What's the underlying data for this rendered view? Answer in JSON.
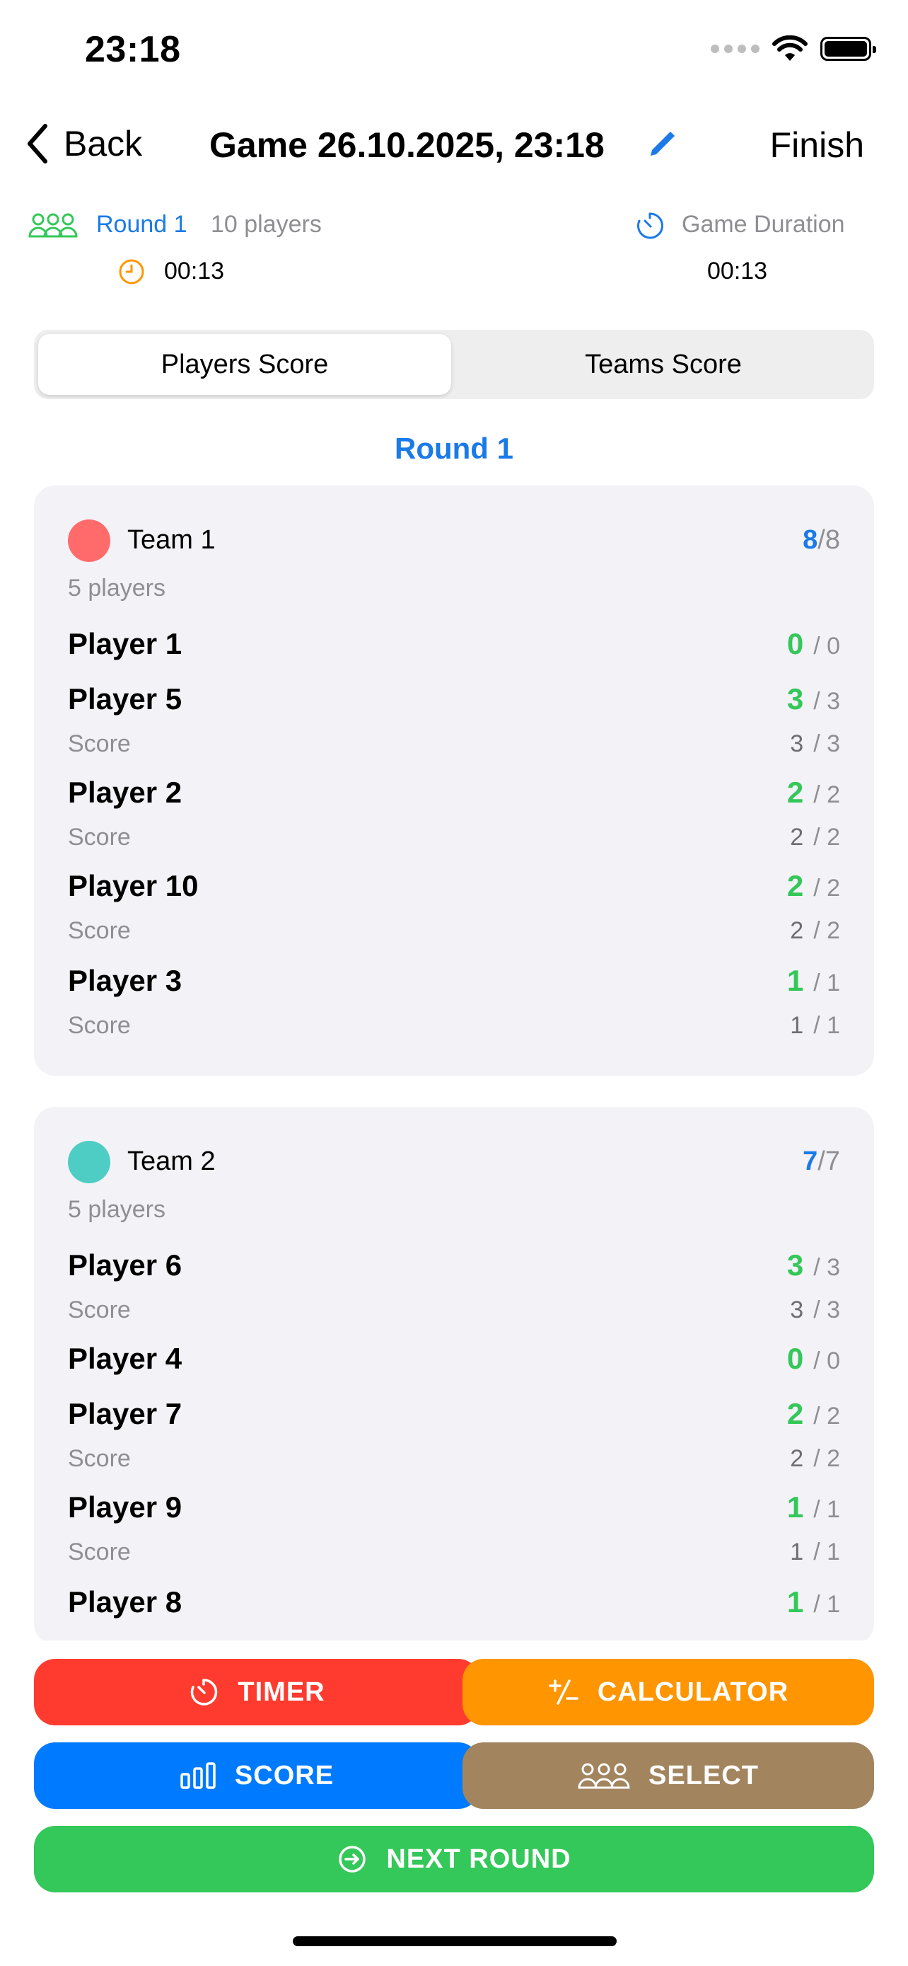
{
  "status": {
    "time": "23:18"
  },
  "nav": {
    "back_label": "Back",
    "title": "Game 26.10.2025, 23:18",
    "finish_label": "Finish"
  },
  "info": {
    "round_label": "Round 1",
    "players_count": "10 players",
    "round_time": "00:13",
    "duration_label": "Game Duration",
    "duration_time": "00:13"
  },
  "tabs": {
    "players": "Players Score",
    "teams": "Teams Score"
  },
  "round_title": "Round 1",
  "teams": [
    {
      "name": "Team 1",
      "color": "#ff6b6b",
      "score": "8",
      "total": "/8",
      "count": "5 players",
      "players": [
        {
          "name": "Player 1",
          "value": "0",
          "total": "/ 0"
        },
        {
          "name": "Player 5",
          "value": "3",
          "total": "/ 3",
          "score_label": "Score",
          "score_value": "3",
          "score_total": "/ 3"
        },
        {
          "name": "Player 2",
          "value": "2",
          "total": "/ 2",
          "score_label": "Score",
          "score_value": "2",
          "score_total": "/ 2"
        },
        {
          "name": "Player 10",
          "value": "2",
          "total": "/ 2",
          "score_label": "Score",
          "score_value": "2",
          "score_total": "/ 2"
        },
        {
          "name": "Player 3",
          "value": "1",
          "total": "/ 1",
          "score_label": "Score",
          "score_value": "1",
          "score_total": "/ 1"
        }
      ]
    },
    {
      "name": "Team 2",
      "color": "#4ecdc4",
      "score": "7",
      "total": "/7",
      "count": "5 players",
      "players": [
        {
          "name": "Player 6",
          "value": "3",
          "total": "/ 3",
          "score_label": "Score",
          "score_value": "3",
          "score_total": "/ 3"
        },
        {
          "name": "Player 4",
          "value": "0",
          "total": "/ 0"
        },
        {
          "name": "Player 7",
          "value": "2",
          "total": "/ 2",
          "score_label": "Score",
          "score_value": "2",
          "score_total": "/ 2"
        },
        {
          "name": "Player 9",
          "value": "1",
          "total": "/ 1",
          "score_label": "Score",
          "score_value": "1",
          "score_total": "/ 1"
        },
        {
          "name": "Player 8",
          "value": "1",
          "total": "/ 1"
        }
      ]
    }
  ],
  "buttons": {
    "timer": "TIMER",
    "calculator": "CALCULATOR",
    "score": "SCORE",
    "select": "SELECT",
    "next_round": "NEXT ROUND"
  },
  "colors": {
    "accent": "#1a7ae8",
    "green": "#34c759",
    "timer_btn": "#ff3b30",
    "calculator_btn": "#ff9500",
    "score_btn": "#007aff",
    "select_btn": "#a2845e",
    "next_btn": "#34c759"
  }
}
